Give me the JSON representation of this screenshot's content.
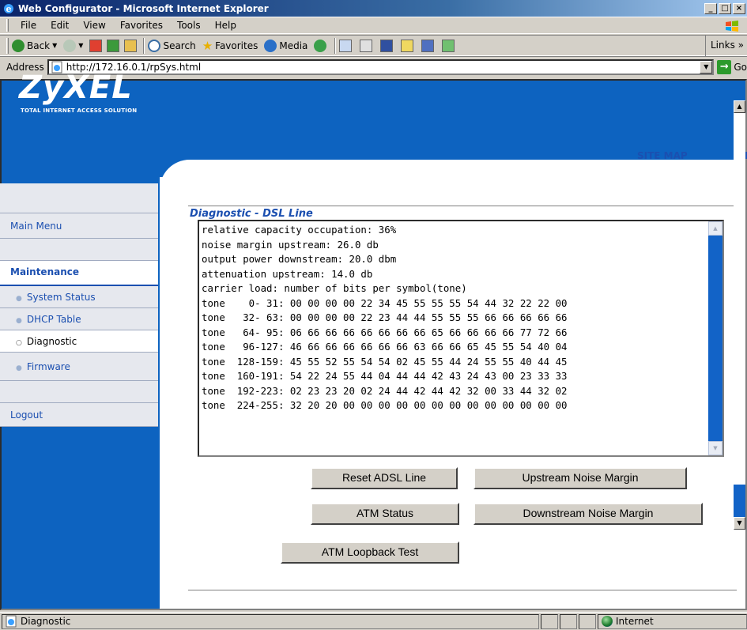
{
  "window": {
    "title": "Web Configurator - Microsoft Internet Explorer",
    "buttons": [
      "_",
      "□",
      "×"
    ]
  },
  "menu": [
    "File",
    "Edit",
    "View",
    "Favorites",
    "Tools",
    "Help"
  ],
  "toolbar": {
    "back": "Back",
    "search": "Search",
    "favorites": "Favorites",
    "media": "Media",
    "links": "Links"
  },
  "address": {
    "label": "Address",
    "url": "http://172.16.0.1/rpSys.html",
    "go": "Go"
  },
  "brand": {
    "logo": "ZyXEL",
    "tagline": "TOTAL INTERNET ACCESS SOLUTION"
  },
  "header_links": {
    "site_map": "SITE MAP",
    "help": "HE"
  },
  "nav": {
    "main_menu": "Main Menu",
    "maintenance": "Maintenance",
    "items": [
      "System Status",
      "DHCP Table",
      "Diagnostic",
      "Firmware"
    ],
    "logout": "Logout"
  },
  "page": {
    "title": "Diagnostic - DSL Line",
    "output": "relative capacity occupation: 36%\nnoise margin upstream: 26.0 db\noutput power downstream: 20.0 dbm\nattenuation upstream: 14.0 db\ncarrier load: number of bits per symbol(tone)\ntone    0- 31: 00 00 00 00 22 34 45 55 55 55 54 44 32 22 22 00\ntone   32- 63: 00 00 00 00 22 23 44 44 55 55 55 66 66 66 66 66\ntone   64- 95: 06 66 66 66 66 66 66 66 65 66 66 66 66 77 72 66\ntone   96-127: 46 66 66 66 66 66 66 63 66 66 65 45 55 54 40 04\ntone  128-159: 45 55 52 55 54 54 02 45 55 44 24 55 55 40 44 45\ntone  160-191: 54 22 24 55 44 04 44 44 42 43 24 43 00 23 33 33\ntone  192-223: 02 23 23 20 02 24 44 42 44 42 32 00 33 44 32 02\ntone  224-255: 32 20 20 00 00 00 00 00 00 00 00 00 00 00 00 00",
    "buttons": {
      "reset": "Reset ADSL Line",
      "upstream": "Upstream Noise Margin",
      "atm_status": "ATM Status",
      "downstream": "Downstream Noise Margin",
      "loopback": "ATM Loopback Test"
    }
  },
  "status": {
    "text": "Diagnostic",
    "zone": "Internet"
  }
}
